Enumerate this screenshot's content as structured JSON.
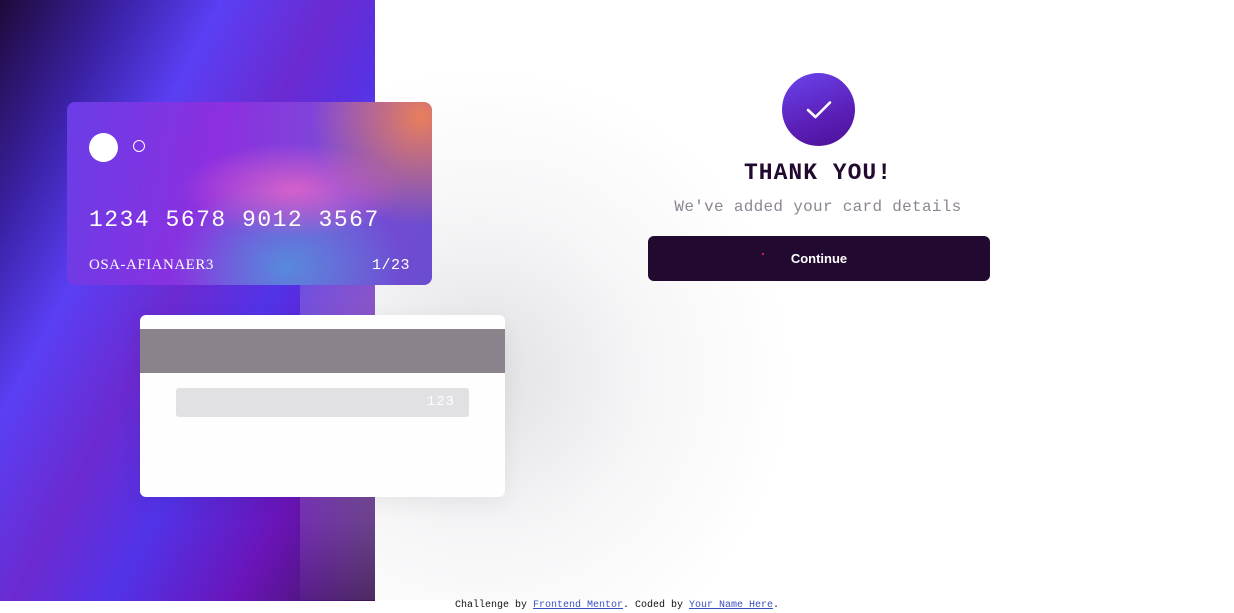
{
  "card_front": {
    "number": "1234 5678 9012 3567",
    "holder_name": "OSA-AFIANAER3",
    "expiry": "1/23"
  },
  "card_back": {
    "cvc": "123"
  },
  "success": {
    "icon": "checkmark-icon",
    "title": "THANK YOU!",
    "message": "We've added your card details",
    "button_label": "Continue"
  },
  "footer": {
    "prefix": "Challenge by ",
    "link1": "Frontend Mentor",
    "middle": ". Coded by ",
    "link2": "Your Name Here",
    "suffix": "."
  },
  "colors": {
    "dark_violet": "#21092f",
    "grayish_violet": "#8e8593",
    "accent_purple": "#6a45ee"
  }
}
